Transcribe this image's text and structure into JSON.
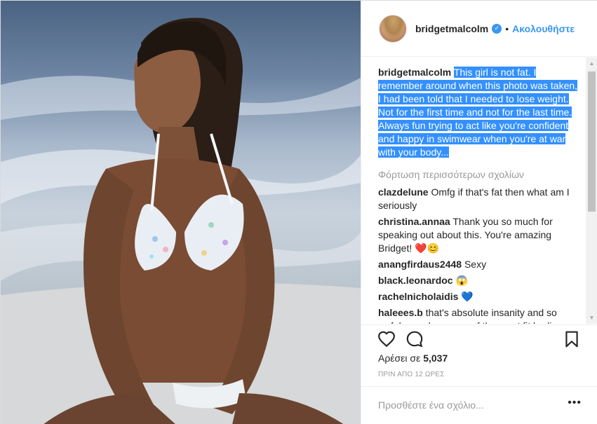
{
  "post": {
    "username": "bridgetmalcolm",
    "follow_label": "Ακολουθήστε",
    "separator": "•",
    "caption_user": "bridgetmalcolm",
    "caption_text": "This girl is not fat. I remember around when this photo was taken, I had been told that I needed to lose weight. Not for the first time and not for the last time. Always fun trying to act like you're confident and happy in swimwear when you're at war with your body...",
    "load_more": "Φόρτωση περισσότερων σχολίων",
    "comments": [
      {
        "user": "clazdelune",
        "text": "Omfg if that's fat then what am I seriously"
      },
      {
        "user": "christina.annaa",
        "text": "Thank you so much for speaking out about this. You're amazing Bridget!",
        "emoji": "❤️😊"
      },
      {
        "user": "anangfirdaus2448",
        "text": "Sexy"
      },
      {
        "user": "black.leonardoc",
        "text": "",
        "emoji": "😱"
      },
      {
        "user": "rachelnicholaidis",
        "text": "",
        "emoji": "💙"
      },
      {
        "user": "haleees.b",
        "text": "that's absolute insanity and so awful - you have one of the most fit bodies"
      }
    ],
    "likes_prefix": "Αρέσει σε",
    "likes_count": "5,037",
    "timestamp": "ΠΡΙΝ ΑΠΟ 12 ΩΡΕΣ",
    "add_comment_placeholder": "Προσθέστε ένα σχόλιο...",
    "more_options": "•••",
    "icons": {
      "like": "heart-icon",
      "comment": "comment-icon",
      "save": "bookmark-icon",
      "verified": "verified-badge-icon"
    },
    "colors": {
      "link": "#3897f0",
      "highlight": "#3390ff",
      "muted": "#999999",
      "text": "#262626"
    }
  }
}
